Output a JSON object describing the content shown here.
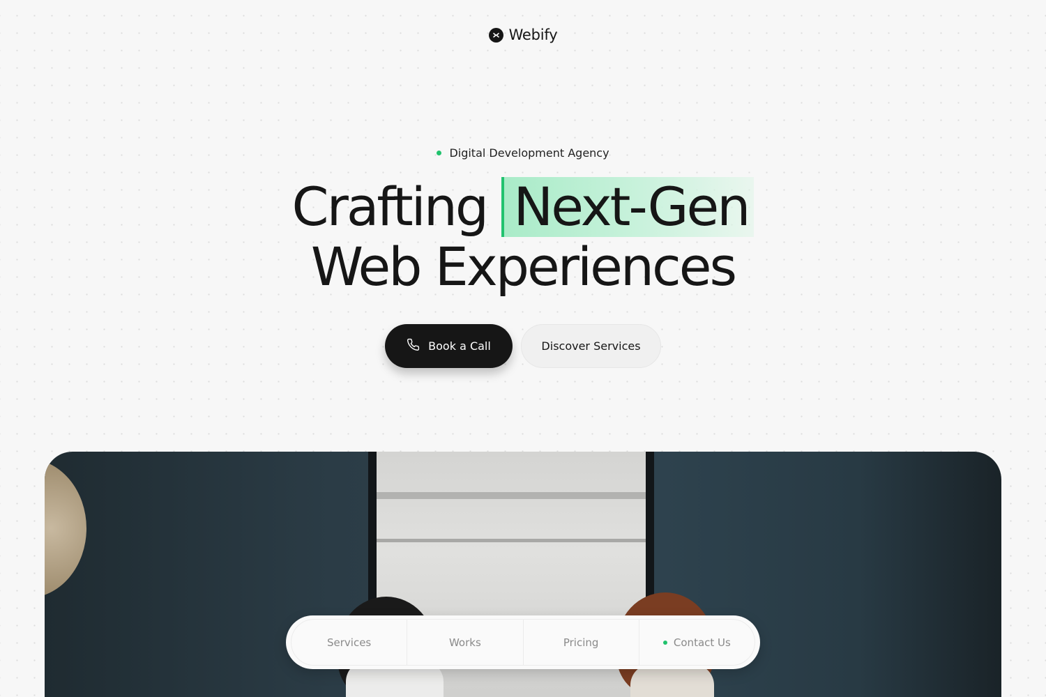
{
  "brand": {
    "name": "Webify",
    "logo_icon": "webify-logo-icon"
  },
  "hero": {
    "tagline": "Digital Development Agency",
    "headline_start": "Crafting",
    "headline_highlight": "Next-Gen",
    "headline_line2": "Web Experiences",
    "primary_cta": {
      "label": "Book a Call",
      "icon": "phone-icon"
    },
    "secondary_cta": {
      "label": "Discover Services"
    }
  },
  "nav": {
    "items": [
      {
        "label": "Services"
      },
      {
        "label": "Works"
      },
      {
        "label": "Pricing"
      },
      {
        "label": "Contact Us",
        "status_dot": true
      }
    ]
  },
  "colors": {
    "accent": "#21c26d",
    "dark": "#161616",
    "background": "#f7f7f7"
  }
}
